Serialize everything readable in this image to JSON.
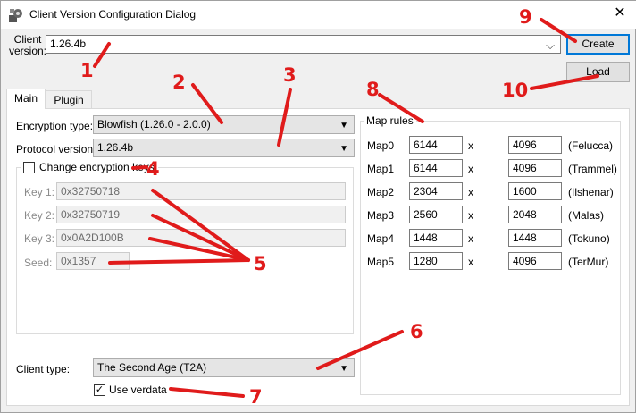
{
  "window": {
    "title": "Client Version Configuration Dialog",
    "close_glyph": "✕"
  },
  "client_version": {
    "label_line1": "Client",
    "label_line2": "version:",
    "value": "1.26.4b"
  },
  "buttons": {
    "create": "Create",
    "load": "Load"
  },
  "tabs": [
    {
      "label": "Main"
    },
    {
      "label": "Plugin"
    }
  ],
  "main": {
    "encryption_type_label": "Encryption type:",
    "encryption_type_value": "Blowfish (1.26.0 - 2.0.0)",
    "protocol_version_label": "Protocol version:",
    "protocol_version_value": "1.26.4b",
    "change_keys_label": "Change encryption keys",
    "change_keys_checked": false,
    "keys": [
      {
        "label": "Key 1:",
        "value": "0x32750718"
      },
      {
        "label": "Key 2:",
        "value": "0x32750719"
      },
      {
        "label": "Key 3:",
        "value": "0x0A2D100B"
      },
      {
        "label": "Seed:",
        "value": "0x1357"
      }
    ],
    "client_type_label": "Client type:",
    "client_type_value": "The Second Age (T2A)",
    "use_verdata_label": "Use verdata",
    "use_verdata_checked": true
  },
  "map_rules": {
    "title": "Map rules",
    "separator": "x",
    "rows": [
      {
        "label": "Map0",
        "width": "6144",
        "height": "4096",
        "name": "(Felucca)"
      },
      {
        "label": "Map1",
        "width": "6144",
        "height": "4096",
        "name": "(Trammel)"
      },
      {
        "label": "Map2",
        "width": "2304",
        "height": "1600",
        "name": "(Ilshenar)"
      },
      {
        "label": "Map3",
        "width": "2560",
        "height": "2048",
        "name": "(Malas)"
      },
      {
        "label": "Map4",
        "width": "1448",
        "height": "1448",
        "name": "(Tokuno)"
      },
      {
        "label": "Map5",
        "width": "1280",
        "height": "4096",
        "name": "(TerMur)"
      }
    ]
  },
  "annotations": {
    "color": "#e01b1b",
    "numbers": [
      "1",
      "2",
      "3",
      "4",
      "5",
      "6",
      "7",
      "8",
      "9",
      "10"
    ]
  },
  "glyphs": {
    "dropdown": "▼",
    "dropdown_thin": "⌵",
    "check": "✓"
  },
  "icons": {
    "app": "app-gear-icon",
    "close": "close-icon"
  }
}
